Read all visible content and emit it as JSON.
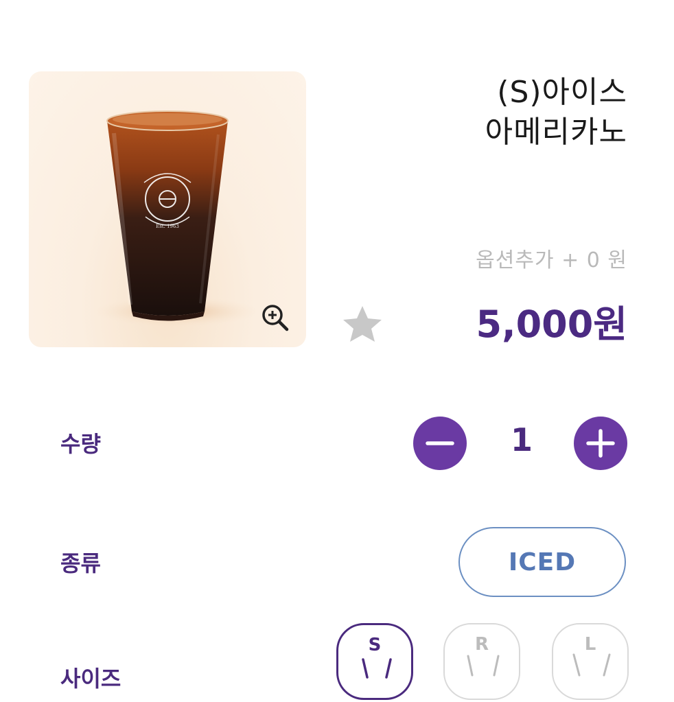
{
  "product": {
    "title_line1": "(S)아이스",
    "title_line2": "아메리카노",
    "option_extra": "옵션추가 + 0 원",
    "price": "5,000원",
    "image_alt": "The Coffee Bean & Tea Leaf iced americano",
    "logo_text": "The Coffee Bean & Tea Leaf Est. 1963"
  },
  "quantity": {
    "label": "수량",
    "value": "1"
  },
  "type": {
    "label": "종류",
    "selected": "ICED"
  },
  "size": {
    "label": "사이즈",
    "options": [
      {
        "letter": "S",
        "state": "selected"
      },
      {
        "letter": "R",
        "state": "unselected"
      },
      {
        "letter": "L",
        "state": "unselected"
      }
    ]
  },
  "colors": {
    "brand_purple": "#4a2a7e",
    "button_purple": "#6a3aa3",
    "iced_blue": "#5578b5"
  },
  "icons": [
    "zoom-in-icon",
    "star-icon",
    "minus-icon",
    "plus-icon",
    "cup-icon"
  ]
}
